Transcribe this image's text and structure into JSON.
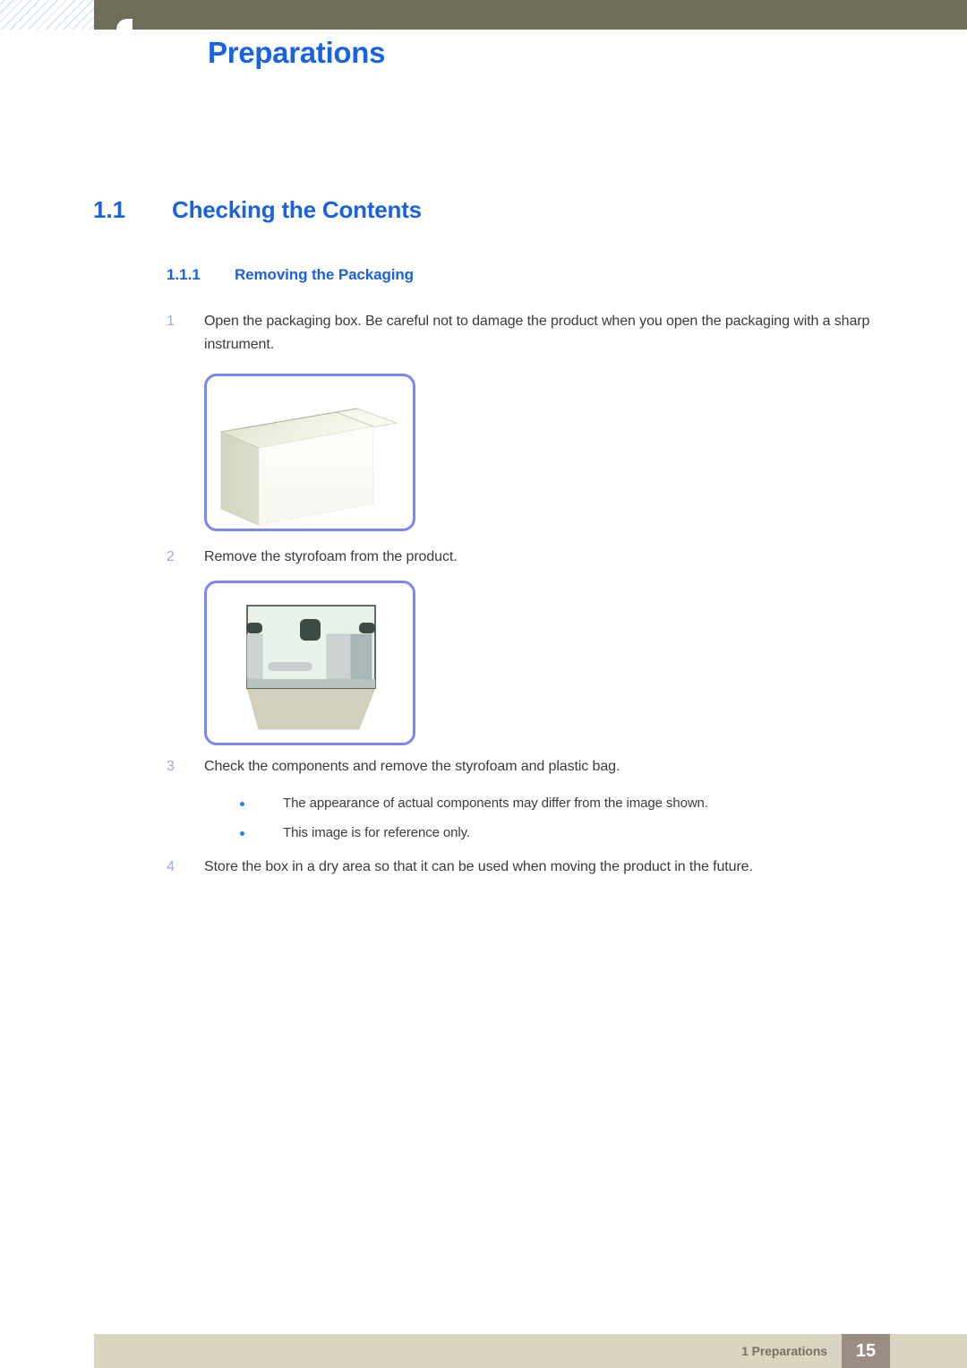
{
  "header": {
    "title": "Preparations"
  },
  "section": {
    "number": "1.1",
    "title": "Checking the Contents"
  },
  "subsection": {
    "number": "1.1.1",
    "title": "Removing the Packaging"
  },
  "steps": [
    {
      "number": "1",
      "text": "Open the packaging box. Be careful not to damage the product when you open the packaging with a sharp instrument."
    },
    {
      "number": "2",
      "text": "Remove the styrofoam from the product."
    },
    {
      "number": "3",
      "text": "Check the components and remove the styrofoam and plastic bag."
    },
    {
      "number": "4",
      "text": "Store the box in a dry area so that it can be used when moving the product in the future."
    }
  ],
  "notes": [
    "The appearance of actual components may differ from the image shown.",
    "This image is for reference only."
  ],
  "figures": [
    {
      "name": "packaging-box-illustration",
      "caption": "open packaging box"
    },
    {
      "name": "styrofoam-illustration",
      "caption": "styrofoam tray inside box"
    }
  ],
  "footer": {
    "label": "1 Preparations",
    "page_number": "15"
  },
  "colors": {
    "heading_blue": "#1a62e0",
    "header_bar_olive": "#6e6d58",
    "step_number_blue": "#9aa9e0",
    "figure_border": "#7c87f2",
    "bullet_blue": "#2b7fe0",
    "footer_bar": "#d9d5c0",
    "footer_page_box": "#9b8d81",
    "footer_text": "#7d6f63",
    "body_text": "#3b3b3b"
  }
}
